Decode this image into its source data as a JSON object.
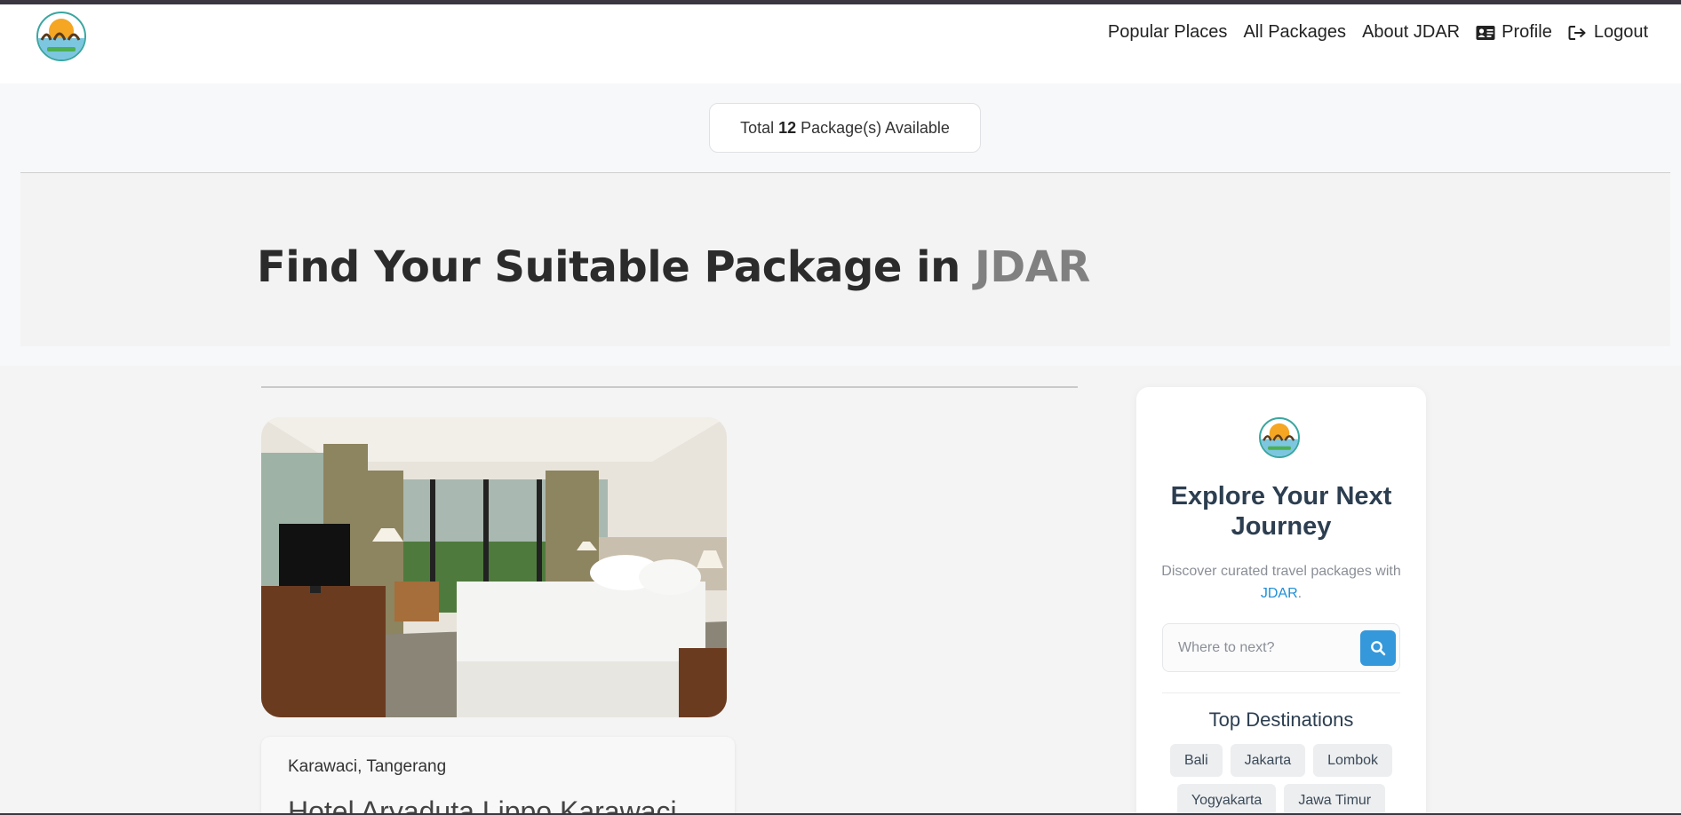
{
  "nav": {
    "links": [
      {
        "label": "Popular Places"
      },
      {
        "label": "All Packages"
      },
      {
        "label": "About JDAR"
      },
      {
        "label": "Profile",
        "icon": "id-card-icon"
      },
      {
        "label": "Logout",
        "icon": "sign-out-icon"
      }
    ]
  },
  "count": {
    "prefix": "Total ",
    "number": "12",
    "suffix": " Package(s) Available"
  },
  "hero": {
    "title": "Find Your Suitable Package in ",
    "brand": "JDAR"
  },
  "package": {
    "location": "Karawaci, Tangerang",
    "title": "Hotel Aryaduta Lippo Karawaci"
  },
  "sidebar": {
    "title": "Explore Your Next Journey",
    "subtitle_prefix": "Discover curated travel packages with ",
    "subtitle_brand": "JDAR",
    "subtitle_suffix": ".",
    "search_placeholder": "Where to next?",
    "top_destinations_title": "Top Destinations",
    "destinations": [
      "Bali",
      "Jakarta",
      "Lombok",
      "Yogyakarta",
      "Jawa Timur"
    ]
  },
  "colors": {
    "accent": "#3498db",
    "brand_highlight": "#1f8fd6",
    "heading": "#2c3e50"
  }
}
